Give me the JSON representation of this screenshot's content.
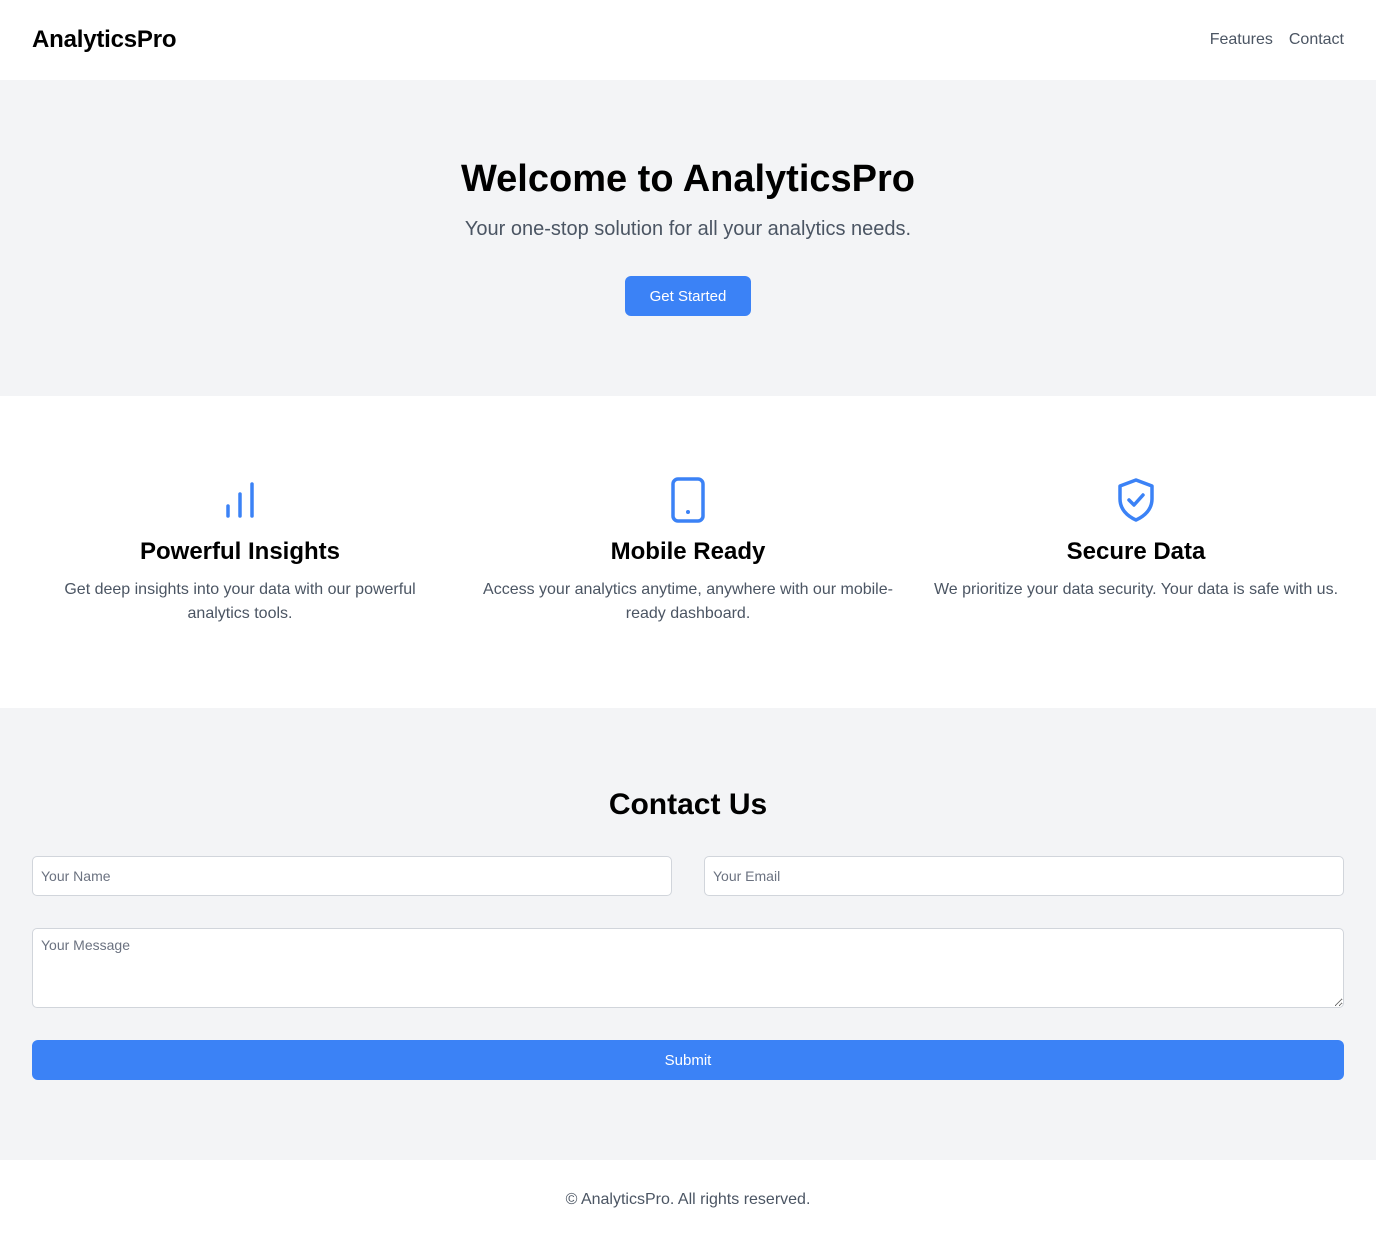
{
  "header": {
    "brand": "AnalyticsPro",
    "nav": [
      {
        "label": "Features"
      },
      {
        "label": "Contact"
      }
    ]
  },
  "hero": {
    "title": "Welcome to AnalyticsPro",
    "subtitle": "Your one-stop solution for all your analytics needs.",
    "cta_label": "Get Started"
  },
  "features": [
    {
      "icon": "bar-chart-icon",
      "title": "Powerful Insights",
      "description": "Get deep insights into your data with our powerful analytics tools."
    },
    {
      "icon": "mobile-phone-icon",
      "title": "Mobile Ready",
      "description": "Access your analytics anytime, anywhere with our mobile-ready dashboard."
    },
    {
      "icon": "shield-check-icon",
      "title": "Secure Data",
      "description": "We prioritize your data security. Your data is safe with us."
    }
  ],
  "contact": {
    "title": "Contact Us",
    "name_placeholder": "Your Name",
    "email_placeholder": "Your Email",
    "message_placeholder": "Your Message",
    "submit_label": "Submit"
  },
  "footer": {
    "text": "© AnalyticsPro. All rights reserved."
  },
  "colors": {
    "accent": "#3b82f6",
    "section_bg": "#f3f4f6",
    "muted_text": "#4b5563"
  }
}
